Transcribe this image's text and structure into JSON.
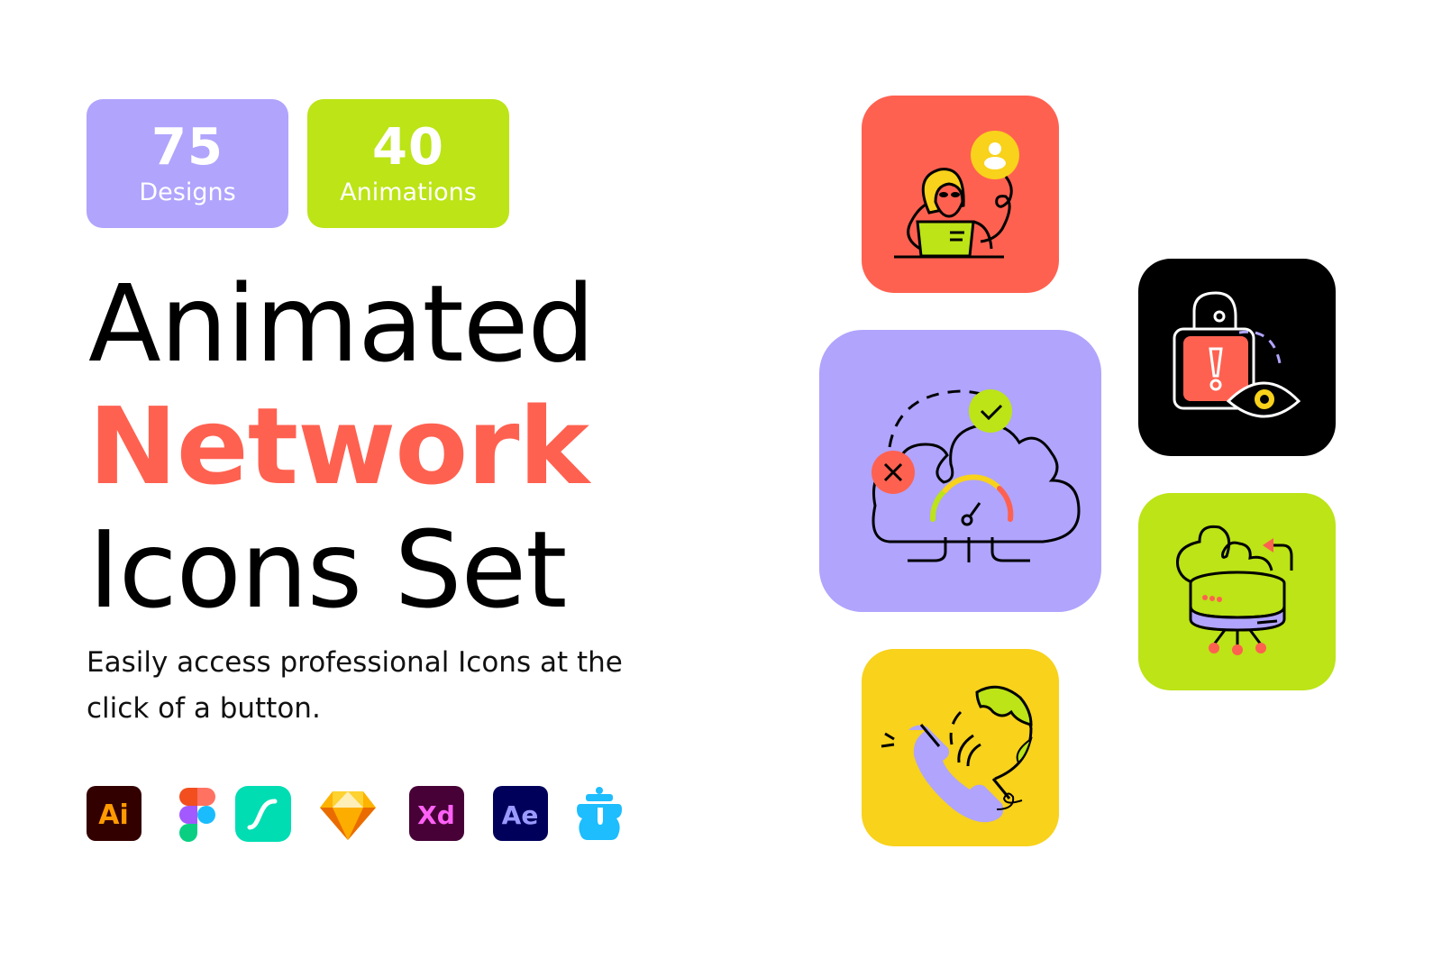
{
  "badges": [
    {
      "number": "75",
      "label": "Designs",
      "color": "#b0a4fd"
    },
    {
      "number": "40",
      "label": "Animations",
      "color": "#bce416"
    }
  ],
  "headline": {
    "line1": "Animated",
    "line2": "Network",
    "line3": "Icons Set",
    "accent_color": "#ff6150"
  },
  "subtitle": "Easily access professional Icons at the click of a button.",
  "tools": [
    {
      "name": "Adobe Illustrator",
      "text": "Ai",
      "icon": "illustrator-icon"
    },
    {
      "name": "Figma",
      "text": "",
      "icon": "figma-icon"
    },
    {
      "name": "LottieFiles",
      "text": "",
      "icon": "lottie-icon"
    },
    {
      "name": "Sketch",
      "text": "",
      "icon": "sketch-icon"
    },
    {
      "name": "Adobe XD",
      "text": "Xd",
      "icon": "xd-icon"
    },
    {
      "name": "Adobe After Effects",
      "text": "Ae",
      "icon": "after-effects-icon"
    },
    {
      "name": "Iconjar",
      "text": "",
      "icon": "iconjar-icon"
    }
  ],
  "icon_tiles": [
    {
      "name": "hacker",
      "icon": "hacker-laptop-icon",
      "color": "#ff6150"
    },
    {
      "name": "cloud speed",
      "icon": "cloud-speed-icon",
      "color": "#b0a4fd"
    },
    {
      "name": "lock alert",
      "icon": "lock-eye-icon",
      "color": "#000000"
    },
    {
      "name": "cloud server",
      "icon": "cloud-server-icon",
      "color": "#bce416"
    },
    {
      "name": "global call",
      "icon": "phone-globe-icon",
      "color": "#f8d21b"
    }
  ]
}
